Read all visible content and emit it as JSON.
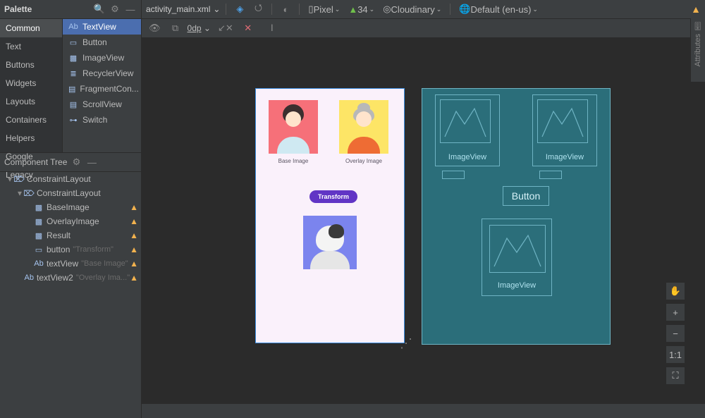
{
  "palette": {
    "title": "Palette",
    "categories": [
      "Common",
      "Text",
      "Buttons",
      "Widgets",
      "Layouts",
      "Containers",
      "Helpers",
      "Google",
      "Legacy"
    ],
    "selected_category": "Common",
    "items": [
      {
        "icon": "Ab",
        "label": "TextView"
      },
      {
        "icon": "▭",
        "label": "Button"
      },
      {
        "icon": "▩",
        "label": "ImageView"
      },
      {
        "icon": "≣",
        "label": "RecyclerView"
      },
      {
        "icon": "▤",
        "label": "FragmentCon..."
      },
      {
        "icon": "▤",
        "label": "ScrollView"
      },
      {
        "icon": "⊶",
        "label": "Switch"
      }
    ],
    "selected_item": "TextView"
  },
  "component_tree": {
    "title": "Component Tree",
    "nodes": [
      {
        "depth": 0,
        "exp": "▾",
        "icon": "⌦",
        "label": "ConstraintLayout",
        "hint": "",
        "warn": false
      },
      {
        "depth": 1,
        "exp": "▾",
        "icon": "⌦",
        "label": "ConstraintLayout",
        "hint": "",
        "warn": false
      },
      {
        "depth": 2,
        "exp": "",
        "icon": "▩",
        "label": "BaseImage",
        "hint": "",
        "warn": true
      },
      {
        "depth": 2,
        "exp": "",
        "icon": "▩",
        "label": "OverlayImage",
        "hint": "",
        "warn": true
      },
      {
        "depth": 2,
        "exp": "",
        "icon": "▩",
        "label": "Result",
        "hint": "",
        "warn": true
      },
      {
        "depth": 2,
        "exp": "",
        "icon": "▭",
        "label": "button",
        "hint": "\"Transform\"",
        "warn": true
      },
      {
        "depth": 2,
        "exp": "",
        "icon": "Ab",
        "label": "textView",
        "hint": "\"Base Image\"",
        "warn": true
      },
      {
        "depth": 2,
        "exp": "",
        "icon": "Ab",
        "label": "textView2",
        "hint": "\"Overlay Ima...\"",
        "warn": true
      }
    ]
  },
  "topbar": {
    "file": "activity_main.xml",
    "device": "Pixel",
    "api": "34",
    "theme": "Cloudinary",
    "locale": "Default (en-us)"
  },
  "secondbar": {
    "dp": "0dp"
  },
  "design": {
    "caption1": "Base Image",
    "caption2": "Overlay Image",
    "button": "Transform"
  },
  "blueprint": {
    "imgview": "ImageView",
    "button": "Button"
  },
  "attr_tab": "Attributes",
  "zoom": {
    "fit": "1:1"
  }
}
